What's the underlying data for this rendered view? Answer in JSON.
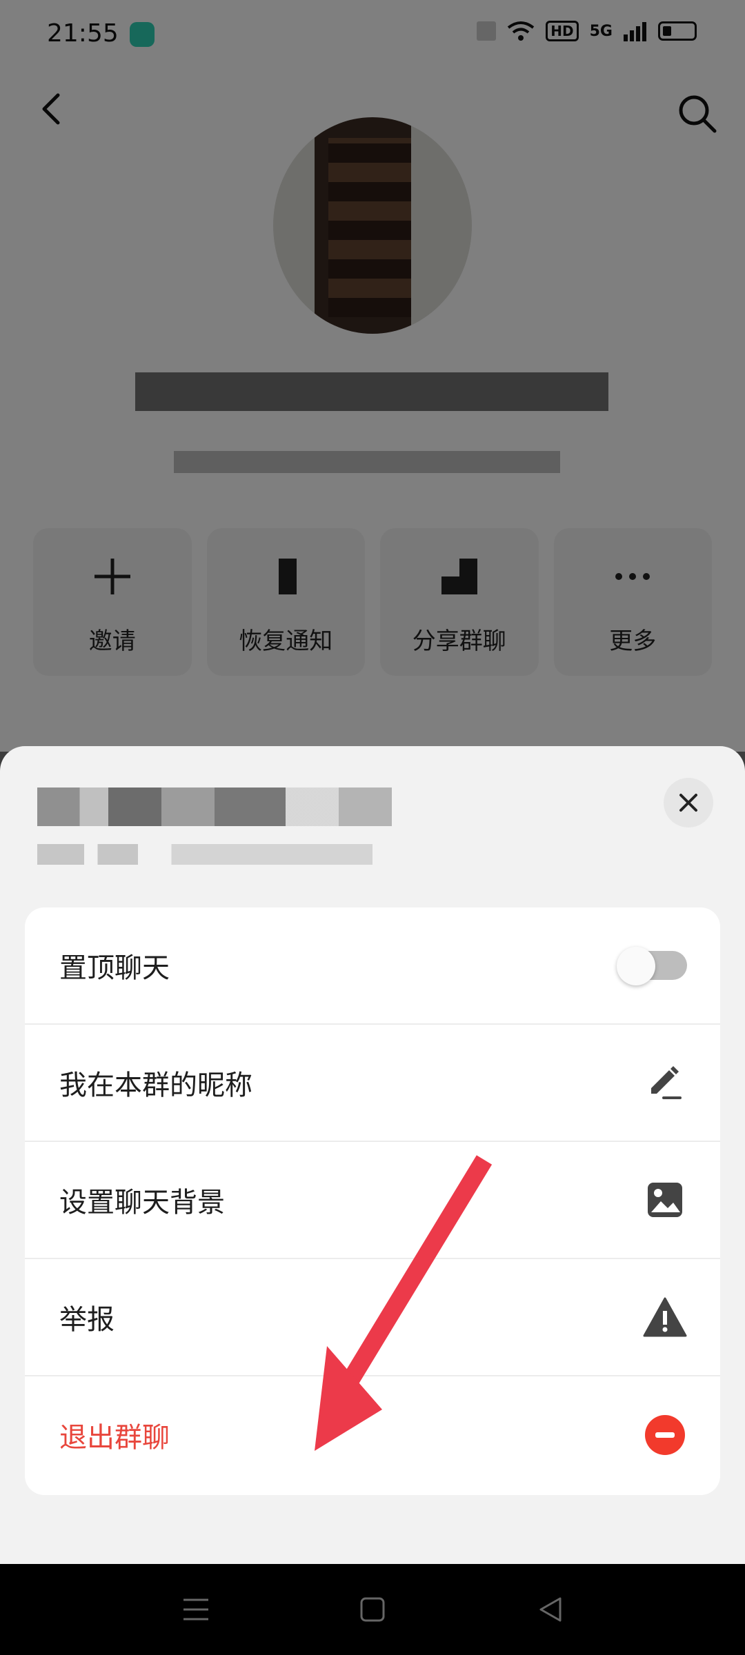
{
  "status_bar": {
    "time": "21:55",
    "hd_label": "HD",
    "network_label": "5G"
  },
  "actions": [
    {
      "label": "邀请",
      "icon": "plus-icon"
    },
    {
      "label": "恢复通知",
      "icon": "bell-icon"
    },
    {
      "label": "分享群聊",
      "icon": "share-icon"
    },
    {
      "label": "更多",
      "icon": "more-icon"
    }
  ],
  "sheet": {
    "rows": [
      {
        "label": "置顶聊天",
        "icon": "toggle",
        "toggle_on": false
      },
      {
        "label": "我在本群的昵称",
        "icon": "pencil-icon"
      },
      {
        "label": "设置聊天背景",
        "icon": "image-icon"
      },
      {
        "label": "举报",
        "icon": "warning-icon"
      },
      {
        "label": "退出群聊",
        "icon": "minus-circle-icon"
      }
    ]
  },
  "colors": {
    "danger": "#e8463c",
    "annotation_arrow": "#ec3a4a",
    "app_badge": "#2fd1b4"
  }
}
